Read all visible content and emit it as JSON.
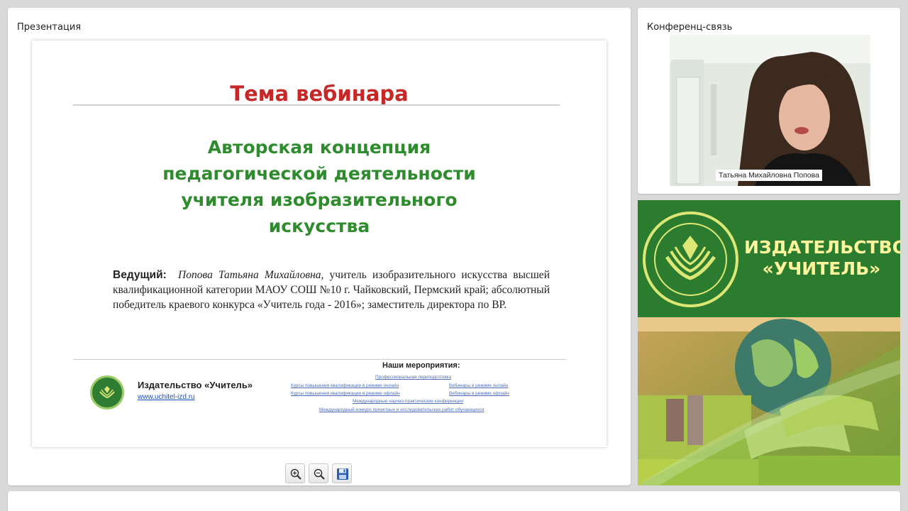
{
  "presentation": {
    "title": "Презентация",
    "slide": {
      "title": "Тема вебинара",
      "subtitle_lines": [
        "Авторская концепция",
        "педагогической деятельности",
        "учителя изобразительного",
        "искусства"
      ],
      "presenter_label": "Ведущий:",
      "presenter_name": "Попова Татьяна Михайловна,",
      "presenter_bio": " учитель изобразительного искусства высшей квалификационной категории МАОУ СОШ №10 г. Чайковский, Пермский край; абсолютный победитель краевого конкурса «Учитель года - 2016»; заместитель директора по ВР.",
      "publisher_name": "Издательство «Учитель»",
      "publisher_url": "www.uchitel-izd.ru",
      "events_title": "Наши мероприятия:",
      "events": [
        "Профессиональная переподготовка",
        "Курсы повышения квалификации в режиме онлайн",
        "Вебинары в режиме онлайн",
        "Курсы повышения квалификации в режиме офлайн",
        "Вебинары в режиме офлайн",
        "Международные научно-практические конференции",
        "Международный конкурс проектных и исследовательских работ обучающихся"
      ]
    },
    "toolbar": {
      "zoom_in": "zoom-in",
      "zoom_out": "zoom-out",
      "save": "save"
    }
  },
  "conference": {
    "title": "Конференц-связь",
    "participant_name": "Татьяна Михайловна Попова"
  },
  "banner": {
    "line1": "ИЗДАТЕЛЬСТВО",
    "line2": "«УЧИТЕЛЬ»"
  },
  "colors": {
    "slide_title": "#c62828",
    "slide_subtitle": "#2e8b2e",
    "banner_green": "#2c7c2f",
    "banner_text": "#fff59d"
  }
}
